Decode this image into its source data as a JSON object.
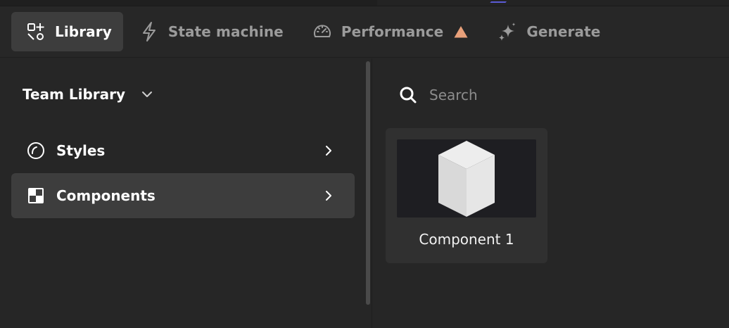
{
  "colors": {
    "background": "#262626",
    "active_item": "#3d3d3d",
    "muted_text": "#9b9b9b",
    "warning": "#e8a07a",
    "thumbnail_bg": "#1e1e22"
  },
  "tabs": [
    {
      "label": "Library",
      "icon": "library-shapes-icon",
      "active": true
    },
    {
      "label": "State machine",
      "icon": "lightning-icon",
      "active": false
    },
    {
      "label": "Performance",
      "icon": "gauge-icon",
      "active": false,
      "badge_icon": "warning-triangle-icon"
    },
    {
      "label": "Generate",
      "icon": "sparkle-icon",
      "active": false
    }
  ],
  "library": {
    "selector_label": "Team Library",
    "selector_icon": "chevron-down-icon",
    "items": [
      {
        "label": "Styles",
        "icon": "styles-circle-icon",
        "active": false
      },
      {
        "label": "Components",
        "icon": "components-grid-icon",
        "active": true
      }
    ]
  },
  "search": {
    "placeholder": "Search",
    "value": ""
  },
  "components": [
    {
      "name": "Component 1",
      "thumbnail_icon": "cube-icon"
    }
  ]
}
